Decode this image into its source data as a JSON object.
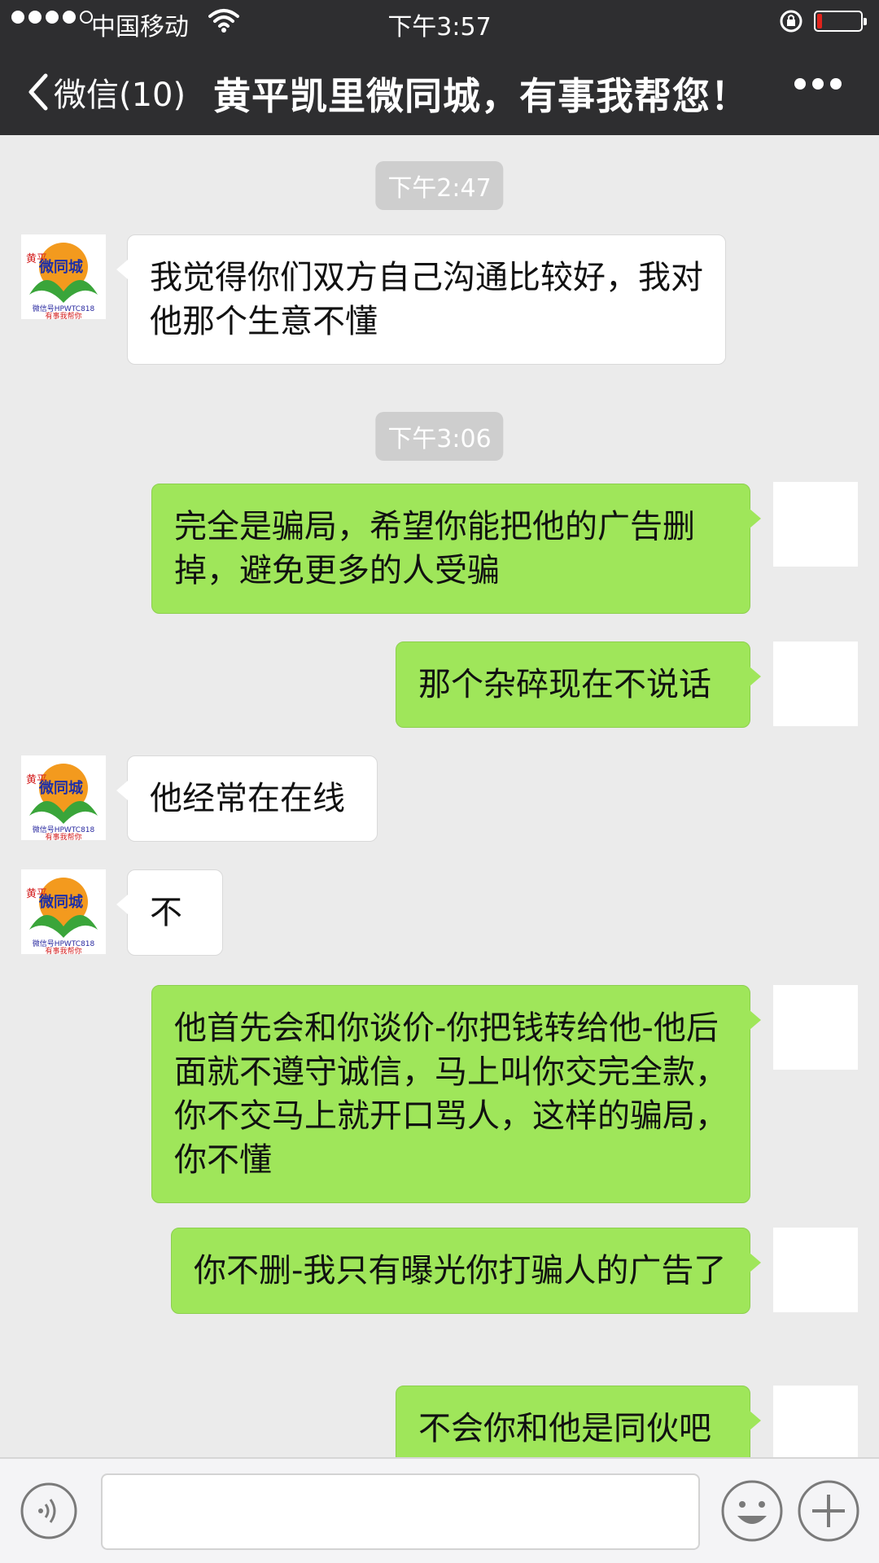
{
  "status_bar": {
    "carrier": "中国移动",
    "time": "下午3:57",
    "signal_bars_filled": 4,
    "signal_bars_total": 5,
    "battery_level_fraction": 0.12,
    "battery_color": "#e0231c"
  },
  "nav": {
    "back_label": "微信(10)",
    "title": "黄平凯里微同城，有事我帮您！"
  },
  "avatar": {
    "left_top": "黄平",
    "left_brand": "微同城",
    "left_id": "微信号HPWTC818",
    "left_slogan": "有事我帮你"
  },
  "chat": {
    "timestamps": [
      "下午2:47",
      "下午3:06"
    ],
    "messages": [
      {
        "side": "in",
        "text": "我觉得你们双方自己沟通比较好，我对他那个生意不懂"
      },
      {
        "side": "out",
        "text": "完全是骗局，希望你能把他的广告删掉，避免更多的人受骗"
      },
      {
        "side": "out",
        "text": "那个杂碎现在不说话"
      },
      {
        "side": "in",
        "text": "他经常在在线"
      },
      {
        "side": "in",
        "text": "不"
      },
      {
        "side": "out",
        "text": "他首先会和你谈价-你把钱转给他-他后面就不遵守诚信，马上叫你交完全款，你不交马上就开口骂人，这样的骗局，你不懂"
      },
      {
        "side": "out",
        "text": "你不删-我只有曝光你打骗人的广告了"
      },
      {
        "side": "out",
        "text": "不会你和他是同伙吧"
      }
    ]
  },
  "colors": {
    "header_bg": "#2e2e30",
    "chat_bg": "#ebebeb",
    "outgoing_bubble": "#9fe65a",
    "incoming_bubble": "#ffffff"
  },
  "input_bar": {
    "voice_icon": "voice-icon",
    "emoji_icon": "emoji-icon",
    "plus_icon": "plus-icon"
  }
}
